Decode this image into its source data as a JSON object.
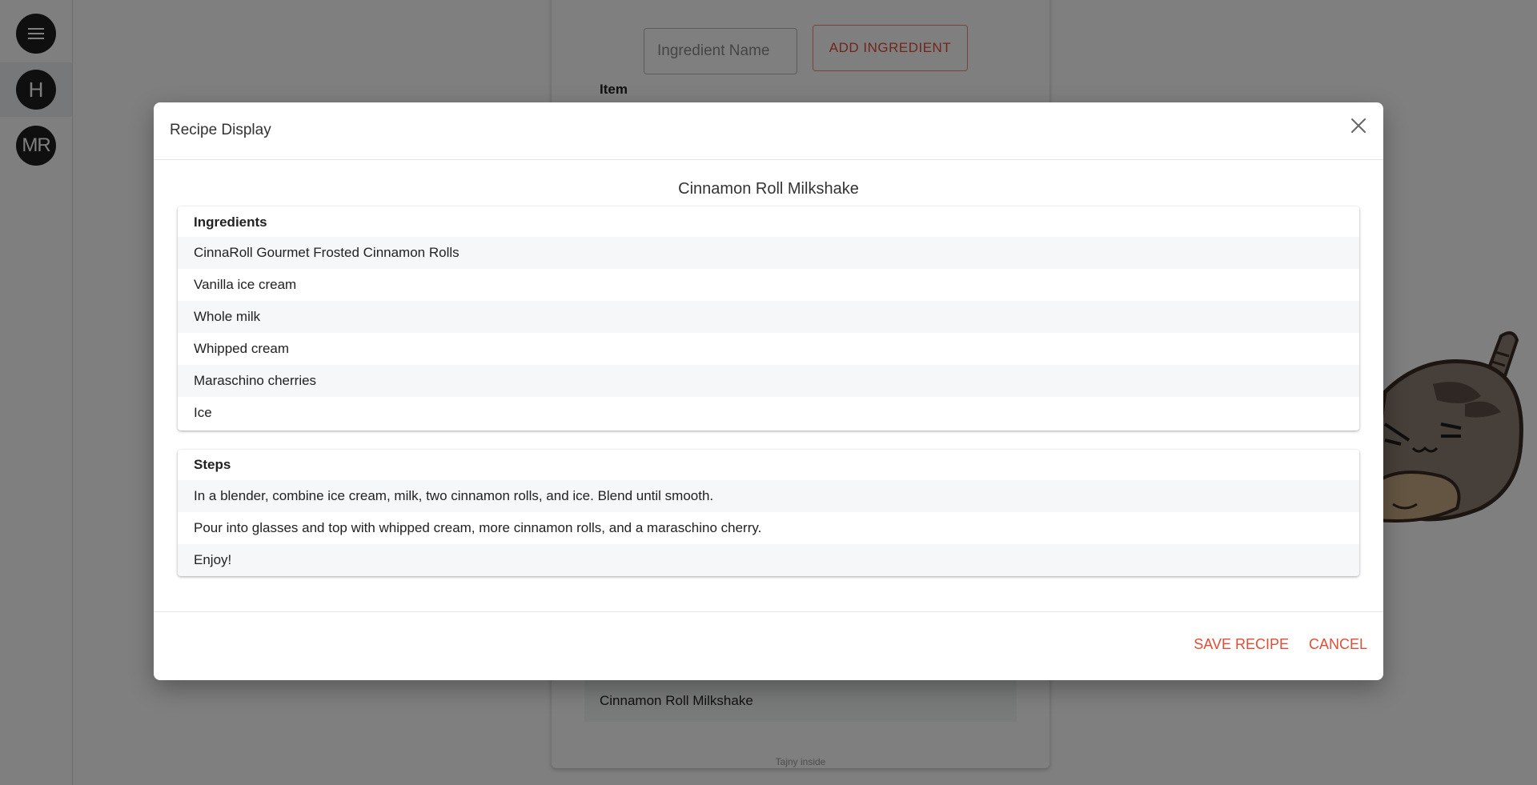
{
  "sidebar": {
    "items": [
      {
        "label": "",
        "icon": "hamburger-menu-icon"
      },
      {
        "label": "H"
      },
      {
        "label": "MR"
      }
    ]
  },
  "background": {
    "ingredient_input_placeholder": "Ingredient Name",
    "add_ingredient_label": "ADD INGREDIENT",
    "item_header": "Item",
    "recipe_row": "Cinnamon Roll Milkshake",
    "footer_text": "Tajny inside"
  },
  "modal": {
    "title": "Recipe Display",
    "recipe_name": "Cinnamon Roll Milkshake",
    "ingredients": {
      "title": "Ingredients",
      "items": [
        "CinnaRoll Gourmet Frosted Cinnamon Rolls",
        "Vanilla ice cream",
        "Whole milk",
        "Whipped cream",
        "Maraschino cherries",
        "Ice"
      ]
    },
    "steps": {
      "title": "Steps",
      "items": [
        "In a blender, combine ice cream, milk, two cinnamon rolls, and ice. Blend until smooth.",
        "Pour into glasses and top with whipped cream, more cinnamon rolls, and a maraschino cherry.",
        "Enjoy!"
      ]
    },
    "save_label": "SAVE RECIPE",
    "cancel_label": "CANCEL"
  },
  "colors": {
    "accent": "#e14d36",
    "overlay": "rgba(0,0,0,0.5)",
    "row_stripe": "#f5f7f8"
  }
}
